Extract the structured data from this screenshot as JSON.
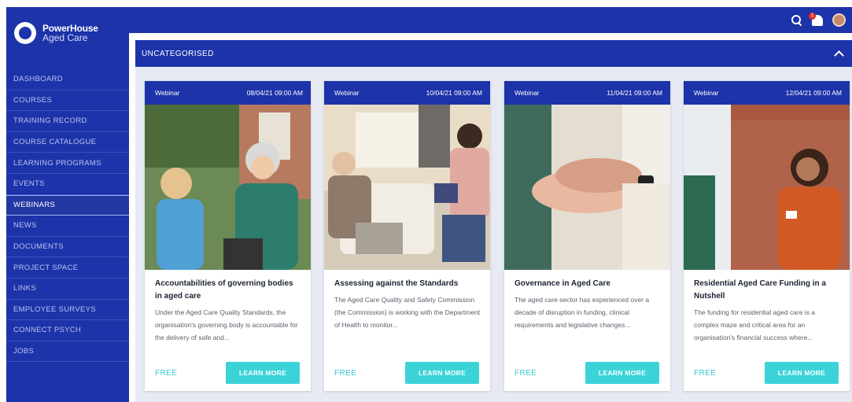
{
  "brand": {
    "line1": "PowerHouse",
    "line2": "Aged Care"
  },
  "sidebar": {
    "items": [
      {
        "label": "DASHBOARD"
      },
      {
        "label": "COURSES"
      },
      {
        "label": "TRAINING RECORD"
      },
      {
        "label": "COURSE CATALOGUE"
      },
      {
        "label": "LEARNING PROGRAMS"
      },
      {
        "label": "EVENTS"
      },
      {
        "label": "WEBINARS"
      },
      {
        "label": "NEWS"
      },
      {
        "label": "DOCUMENTS"
      },
      {
        "label": "PROJECT SPACE"
      },
      {
        "label": "LINKS"
      },
      {
        "label": "EMPLOYEE SURVEYS"
      },
      {
        "label": "CONNECT PSYCH"
      },
      {
        "label": "JOBS"
      }
    ],
    "active": "WEBINARS"
  },
  "topbar": {
    "notification_count": "1",
    "icons": [
      "search-icon",
      "bell-icon",
      "user-avatar"
    ]
  },
  "section": {
    "title": "UNCATEGORISED"
  },
  "colors": {
    "primary": "#1d33a9",
    "accent": "#3cd3d8"
  },
  "cards": [
    {
      "type": "Webinar",
      "date": "08/04/21 09:00 AM",
      "title": "Accountabilities of governing bodies in aged care",
      "description": "Under the Aged Care Quality Standards, the organisation's governing body is accountable for the delivery of safe and...",
      "price": "FREE",
      "button": "LEARN MORE"
    },
    {
      "type": "Webinar",
      "date": "10/04/21 09:00 AM",
      "title": "Assessing against the Standards",
      "description": "The Aged Care Quality and Safety Commission (the Commission) is working with the Department of Health to monitor...",
      "price": "FREE",
      "button": "LEARN MORE"
    },
    {
      "type": "Webinar",
      "date": "11/04/21 09:00 AM",
      "title": "Governance in Aged Care",
      "description": "The aged care sector has experienced over a decade of disruption in funding, clinical requirements and legislative changes...",
      "price": "FREE",
      "button": "LEARN MORE"
    },
    {
      "type": "Webinar",
      "date": "12/04/21 09:00 AM",
      "title": "Residential Aged Care Funding in a Nutshell",
      "description": "The funding for residential aged care is a complex maze and critical area for an organisation's financial success where...",
      "price": "FREE",
      "button": "LEARN MORE"
    }
  ]
}
